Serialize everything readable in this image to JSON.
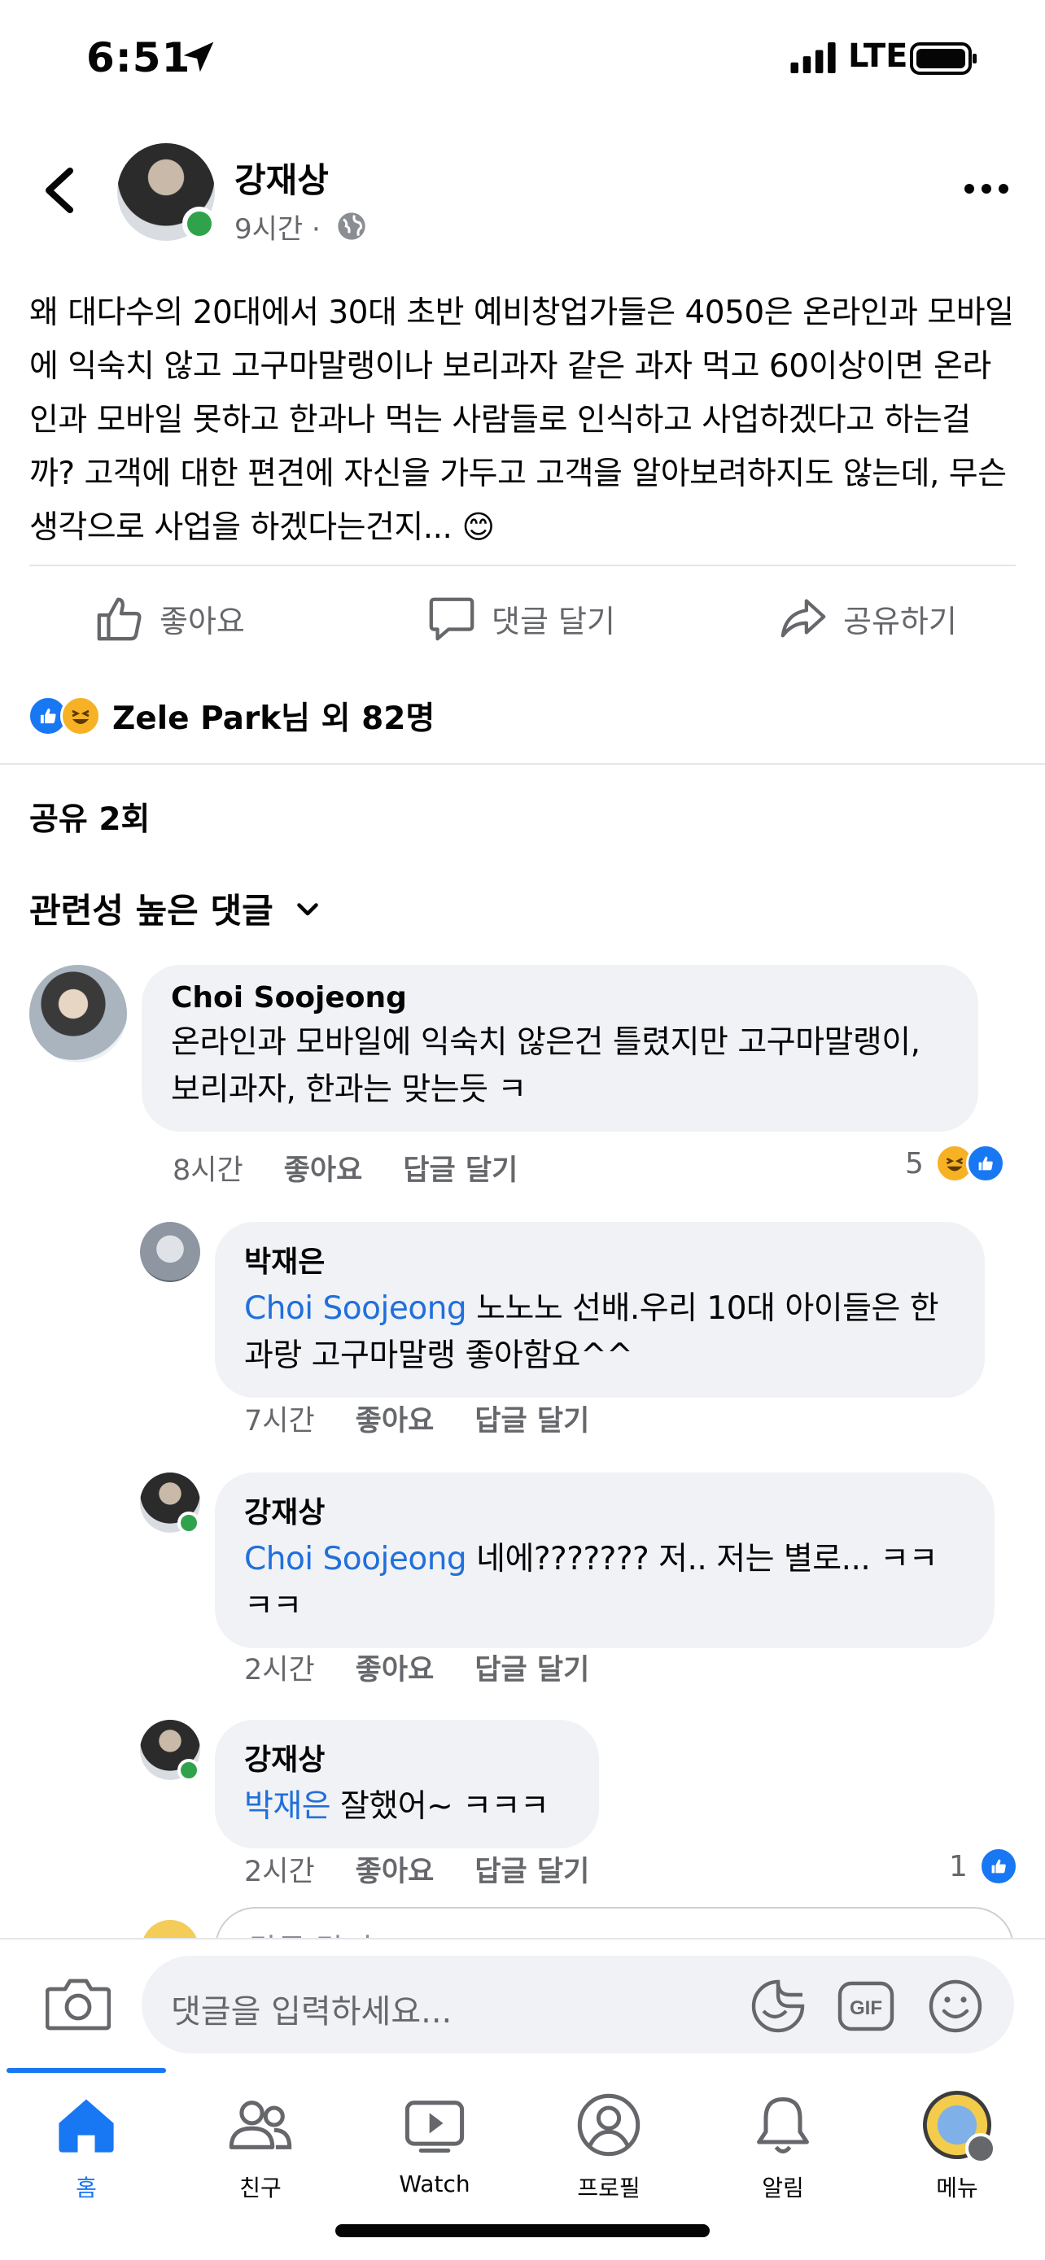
{
  "status_bar": {
    "time": "6:51",
    "network": "LTE"
  },
  "post": {
    "author": "강재상",
    "time": "9시간 ·",
    "text": "왜 대다수의 20대에서 30대 초반 예비창업가들은 4050은 온라인과 모바일에 익숙치 않고 고구마말랭이나 보리과자 같은 과자 먹고 60이상이면 온라인과 모바일 못하고 한과나 먹는 사람들로 인식하고 사업하겠다고 하는걸까? 고객에 대한 편견에 자신을 가두고 고객을 알아보려하지도 않는데, 무슨 생각으로 사업을 하겠다는건지... 😊"
  },
  "actions": {
    "like": "좋아요",
    "comment": "댓글 달기",
    "share": "공유하기"
  },
  "reactions_summary": "Zele Park님 외 82명",
  "share_count": "공유 2회",
  "sort_label": "관련성 높은 댓글",
  "comments": [
    {
      "name": "Choi Soojeong",
      "mention": "",
      "text": "온라인과 모바일에 익숙치 않은건 틀렸지만 고구마말랭이, 보리과자, 한과는 맞는듯 ㅋ",
      "time": "8시간",
      "like": "좋아요",
      "reply": "답글 달기",
      "reaction_count": "5"
    },
    {
      "name": "박재은",
      "mention": "Choi Soojeong",
      "text": " 노노노 선배.우리 10대 아이들은 한과랑 고구마말랭 좋아함요^^",
      "time": "7시간",
      "like": "좋아요",
      "reply": "답글 달기"
    },
    {
      "name": "강재상",
      "mention": "Choi Soojeong",
      "text": " 네에??????? 저.. 저는 별로... ㅋㅋㅋㅋ",
      "time": "2시간",
      "like": "좋아요",
      "reply": "답글 달기"
    },
    {
      "name": "강재상",
      "mention": "박재은",
      "text": " 잘했어~ ㅋㅋㅋ",
      "time": "2시간",
      "like": "좋아요",
      "reply": "답글 달기",
      "reaction_count": "1"
    }
  ],
  "reply_peek_placeholder": "답글 달기...",
  "composer": {
    "placeholder": "댓글을 입력하세요..."
  },
  "nav": {
    "home": "홈",
    "friends": "친구",
    "watch": "Watch",
    "profile": "프로필",
    "notifications": "알림",
    "menu": "메뉴"
  },
  "colors": {
    "accent": "#1877f2",
    "mention": "#216fdb",
    "online": "#31a24c",
    "bubble": "#f0f2f5",
    "secondary_text": "#65676b"
  },
  "icons": [
    "back-icon",
    "more-icon",
    "globe-icon",
    "like-icon",
    "comment-icon",
    "share-icon",
    "camera-icon",
    "sticker-icon",
    "gif-icon",
    "emoji-icon",
    "home-icon",
    "friends-icon",
    "watch-icon",
    "profile-icon",
    "bell-icon"
  ]
}
